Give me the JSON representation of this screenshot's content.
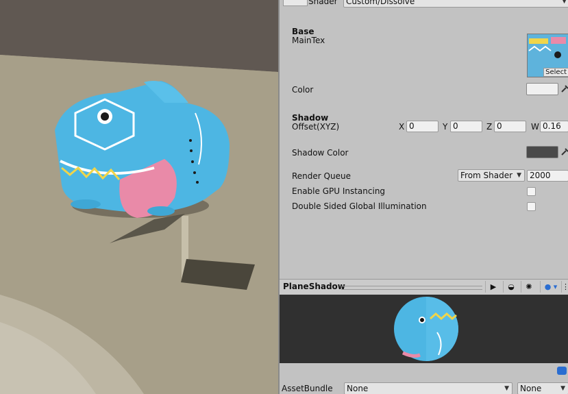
{
  "inspector": {
    "shader_label": "Shader",
    "shader_value": "Custom/Dissolve",
    "base": {
      "header": "Base",
      "maintex_label": "MainTex",
      "select_label": "Select"
    },
    "color": {
      "label": "Color",
      "value": "#f0f0f0"
    },
    "shadow": {
      "header": "Shadow",
      "offset_label": "Offset(XYZ)",
      "x_label": "X",
      "x_value": "0",
      "y_label": "Y",
      "y_value": "0",
      "z_label": "Z",
      "z_value": "0",
      "w_label": "W",
      "w_value": "0.16"
    },
    "shadow_color": {
      "label": "Shadow Color",
      "value": "#4a4a4a"
    },
    "render_queue": {
      "label": "Render Queue",
      "mode": "From Shader",
      "value": "2000"
    },
    "gpu_instancing": {
      "label": "Enable GPU Instancing",
      "checked": false
    },
    "double_sided_gi": {
      "label": "Double Sided Global Illumination",
      "checked": false
    }
  },
  "preview": {
    "title": "PlaneShadow"
  },
  "asset_bundle": {
    "label": "AssetBundle",
    "value": "None",
    "variant": "None"
  },
  "colors": {
    "inspector_bg": "#c2c2c2",
    "scene_floor": "#a59f8b",
    "scene_sky": "#605852",
    "elephant_blue": "#4db6e3",
    "ear_pink": "#e98aa8",
    "preview_bg": "#303030"
  }
}
